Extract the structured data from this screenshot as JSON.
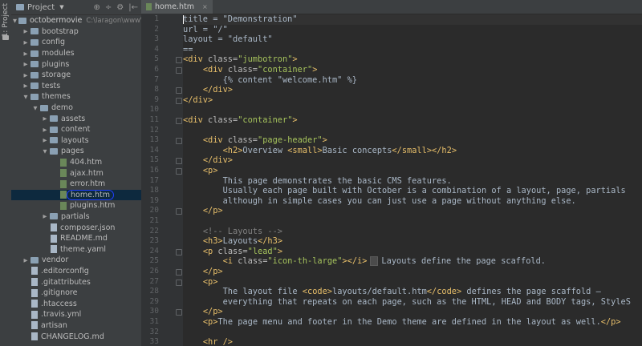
{
  "side_strip": {
    "label": "1: Project"
  },
  "project_panel": {
    "title": "Project",
    "tools": [
      "⊕",
      "÷",
      "⚙",
      "|←"
    ],
    "root_name": "octobermovie",
    "root_path": "C:\\laragon\\www\\oc",
    "items": [
      {
        "label": "bootstrap",
        "type": "folder",
        "depth": 1,
        "arrow": "▶"
      },
      {
        "label": "config",
        "type": "folder",
        "depth": 1,
        "arrow": "▶"
      },
      {
        "label": "modules",
        "type": "folder",
        "depth": 1,
        "arrow": "▶"
      },
      {
        "label": "plugins",
        "type": "folder",
        "depth": 1,
        "arrow": "▶"
      },
      {
        "label": "storage",
        "type": "folder",
        "depth": 1,
        "arrow": "▶"
      },
      {
        "label": "tests",
        "type": "folder",
        "depth": 1,
        "arrow": "▶"
      },
      {
        "label": "themes",
        "type": "folder",
        "depth": 1,
        "arrow": "▼"
      },
      {
        "label": "demo",
        "type": "folder",
        "depth": 2,
        "arrow": "▼"
      },
      {
        "label": "assets",
        "type": "folder",
        "depth": 3,
        "arrow": "▶"
      },
      {
        "label": "content",
        "type": "folder",
        "depth": 3,
        "arrow": "▶"
      },
      {
        "label": "layouts",
        "type": "folder",
        "depth": 3,
        "arrow": "▶"
      },
      {
        "label": "pages",
        "type": "folder",
        "depth": 3,
        "arrow": "▼"
      },
      {
        "label": "404.htm",
        "type": "html",
        "depth": 4,
        "arrow": ""
      },
      {
        "label": "ajax.htm",
        "type": "html",
        "depth": 4,
        "arrow": ""
      },
      {
        "label": "error.htm",
        "type": "html",
        "depth": 4,
        "arrow": ""
      },
      {
        "label": "home.htm",
        "type": "html",
        "depth": 4,
        "arrow": "",
        "selected": true
      },
      {
        "label": "plugins.htm",
        "type": "html",
        "depth": 4,
        "arrow": ""
      },
      {
        "label": "partials",
        "type": "folder",
        "depth": 3,
        "arrow": "▶"
      },
      {
        "label": "composer.json",
        "type": "file",
        "depth": 3,
        "arrow": ""
      },
      {
        "label": "README.md",
        "type": "file",
        "depth": 3,
        "arrow": ""
      },
      {
        "label": "theme.yaml",
        "type": "file",
        "depth": 3,
        "arrow": ""
      },
      {
        "label": "vendor",
        "type": "folder",
        "depth": 1,
        "arrow": "▶"
      },
      {
        "label": ".editorconfig",
        "type": "file",
        "depth": 1,
        "arrow": ""
      },
      {
        "label": ".gitattributes",
        "type": "file",
        "depth": 1,
        "arrow": ""
      },
      {
        "label": ".gitignore",
        "type": "file",
        "depth": 1,
        "arrow": ""
      },
      {
        "label": ".htaccess",
        "type": "file",
        "depth": 1,
        "arrow": ""
      },
      {
        "label": ".travis.yml",
        "type": "file",
        "depth": 1,
        "arrow": ""
      },
      {
        "label": "artisan",
        "type": "file",
        "depth": 1,
        "arrow": ""
      },
      {
        "label": "CHANGELOG.md",
        "type": "file",
        "depth": 1,
        "arrow": ""
      }
    ]
  },
  "editor": {
    "tab_label": "home.htm",
    "tab_close": "×",
    "lines": [
      {
        "n": "1",
        "fold": false,
        "parts": [
          [
            "cursor",
            ""
          ],
          [
            "fg",
            "title = \"Demonstration\""
          ]
        ]
      },
      {
        "n": "2",
        "fold": false,
        "parts": [
          [
            "fg",
            "url = \"/\""
          ]
        ]
      },
      {
        "n": "3",
        "fold": false,
        "parts": [
          [
            "fg",
            "layout = \"default\""
          ]
        ]
      },
      {
        "n": "4",
        "fold": false,
        "parts": [
          [
            "fg",
            "=="
          ]
        ]
      },
      {
        "n": "5",
        "fold": true,
        "parts": [
          [
            "t",
            "<div "
          ],
          [
            "a",
            "class="
          ],
          [
            "s",
            "\"jumbotron\""
          ],
          [
            "t",
            ">"
          ]
        ]
      },
      {
        "n": "6",
        "fold": true,
        "parts": [
          [
            "fg",
            "    "
          ],
          [
            "t",
            "<div "
          ],
          [
            "a",
            "class="
          ],
          [
            "s",
            "\"container\""
          ],
          [
            "t",
            ">"
          ]
        ]
      },
      {
        "n": "7",
        "fold": false,
        "parts": [
          [
            "fg",
            "        {% content \"welcome.htm\" %}"
          ]
        ]
      },
      {
        "n": "8",
        "fold": true,
        "parts": [
          [
            "fg",
            "    "
          ],
          [
            "t",
            "</div>"
          ]
        ]
      },
      {
        "n": "9",
        "fold": true,
        "parts": [
          [
            "t",
            "</div>"
          ]
        ]
      },
      {
        "n": "10",
        "fold": false,
        "parts": []
      },
      {
        "n": "11",
        "fold": true,
        "parts": [
          [
            "t",
            "<div "
          ],
          [
            "a",
            "class="
          ],
          [
            "s",
            "\"container\""
          ],
          [
            "t",
            ">"
          ]
        ]
      },
      {
        "n": "12",
        "fold": false,
        "parts": []
      },
      {
        "n": "13",
        "fold": true,
        "parts": [
          [
            "fg",
            "    "
          ],
          [
            "t",
            "<div "
          ],
          [
            "a",
            "class="
          ],
          [
            "s",
            "\"page-header\""
          ],
          [
            "t",
            ">"
          ]
        ]
      },
      {
        "n": "14",
        "fold": false,
        "parts": [
          [
            "fg",
            "        "
          ],
          [
            "t",
            "<h2>"
          ],
          [
            "fg",
            "Overview "
          ],
          [
            "t",
            "<small>"
          ],
          [
            "fg",
            "Basic concepts"
          ],
          [
            "t",
            "</small></h2>"
          ]
        ]
      },
      {
        "n": "15",
        "fold": true,
        "parts": [
          [
            "fg",
            "    "
          ],
          [
            "t",
            "</div>"
          ]
        ]
      },
      {
        "n": "16",
        "fold": true,
        "parts": [
          [
            "fg",
            "    "
          ],
          [
            "t",
            "<p>"
          ]
        ]
      },
      {
        "n": "17",
        "fold": false,
        "parts": [
          [
            "fg",
            "        This page demonstrates the basic CMS features."
          ]
        ]
      },
      {
        "n": "18",
        "fold": false,
        "parts": [
          [
            "fg",
            "        Usually each page built with October is a combination of a layout, page, partials"
          ]
        ]
      },
      {
        "n": "19",
        "fold": false,
        "parts": [
          [
            "fg",
            "        although in simple cases you can just use a page without anything else."
          ]
        ]
      },
      {
        "n": "20",
        "fold": true,
        "parts": [
          [
            "fg",
            "    "
          ],
          [
            "t",
            "</p>"
          ]
        ]
      },
      {
        "n": "21",
        "fold": false,
        "parts": []
      },
      {
        "n": "22",
        "fold": false,
        "parts": [
          [
            "fg",
            "    "
          ],
          [
            "c",
            "<!-- Layouts -->"
          ]
        ]
      },
      {
        "n": "23",
        "fold": false,
        "parts": [
          [
            "fg",
            "    "
          ],
          [
            "t",
            "<h3>"
          ],
          [
            "fg",
            "Layouts"
          ],
          [
            "t",
            "</h3>"
          ]
        ]
      },
      {
        "n": "24",
        "fold": true,
        "parts": [
          [
            "fg",
            "    "
          ],
          [
            "t",
            "<p "
          ],
          [
            "a",
            "class="
          ],
          [
            "s",
            "\"lead\""
          ],
          [
            "t",
            ">"
          ]
        ]
      },
      {
        "n": "25",
        "fold": false,
        "parts": [
          [
            "fg",
            "        "
          ],
          [
            "t",
            "<i "
          ],
          [
            "a",
            "class="
          ],
          [
            "s",
            "\"icon-th-large\""
          ],
          [
            "t",
            "></i>"
          ],
          [
            "bulb",
            ""
          ],
          [
            "fg",
            "Layouts define the page scaffold."
          ]
        ]
      },
      {
        "n": "26",
        "fold": true,
        "parts": [
          [
            "fg",
            "    "
          ],
          [
            "t",
            "</p>"
          ]
        ]
      },
      {
        "n": "27",
        "fold": true,
        "parts": [
          [
            "fg",
            "    "
          ],
          [
            "t",
            "<p>"
          ]
        ]
      },
      {
        "n": "28",
        "fold": false,
        "parts": [
          [
            "fg",
            "        The layout file "
          ],
          [
            "t",
            "<code>"
          ],
          [
            "fg",
            "layouts/default.htm"
          ],
          [
            "t",
            "</code>"
          ],
          [
            "fg",
            " defines the page scaffold —"
          ]
        ]
      },
      {
        "n": "29",
        "fold": false,
        "parts": [
          [
            "fg",
            "        everything that repeats on each page, such as the HTML, HEAD and BODY tags, StyleS"
          ]
        ]
      },
      {
        "n": "30",
        "fold": true,
        "parts": [
          [
            "fg",
            "    "
          ],
          [
            "t",
            "</p>"
          ]
        ]
      },
      {
        "n": "31",
        "fold": false,
        "parts": [
          [
            "fg",
            "    "
          ],
          [
            "t",
            "<p>"
          ],
          [
            "fg",
            "The page menu and footer in the Demo theme are defined in the layout as well."
          ],
          [
            "t",
            "</p>"
          ]
        ]
      },
      {
        "n": "32",
        "fold": false,
        "parts": []
      },
      {
        "n": "33",
        "fold": false,
        "parts": [
          [
            "fg",
            "    "
          ],
          [
            "t",
            "<hr />"
          ]
        ]
      }
    ]
  }
}
